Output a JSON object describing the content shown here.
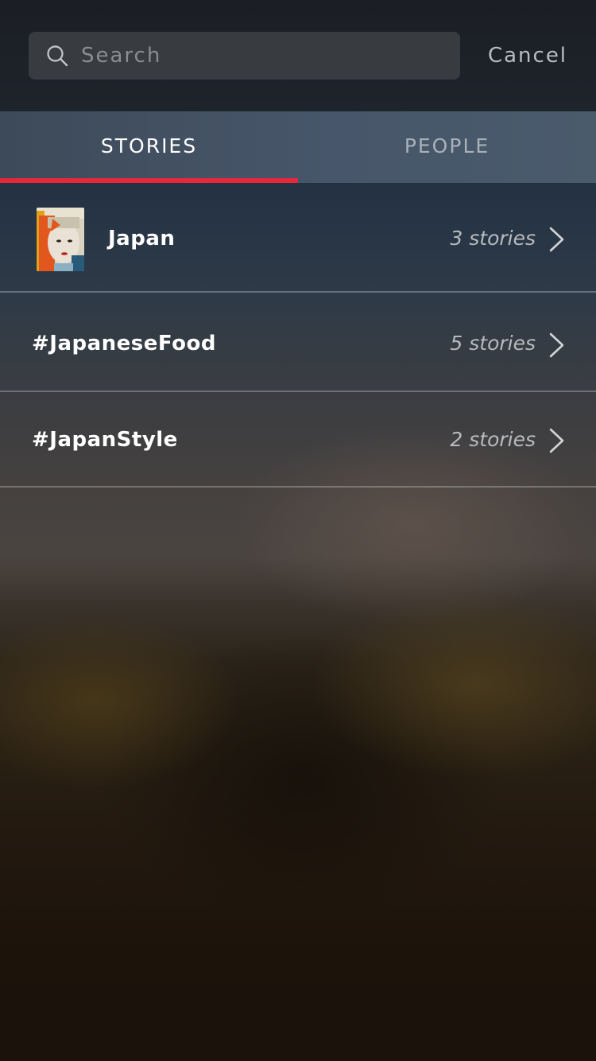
{
  "search": {
    "placeholder": "Search",
    "value": "",
    "icon": "search-icon",
    "cancel_label": "Cancel"
  },
  "tabs": [
    {
      "label": "STORIES",
      "active": true
    },
    {
      "label": "PEOPLE",
      "active": false
    }
  ],
  "colors": {
    "accent": "#e8283a",
    "tab_active_text": "#ffffff",
    "tab_inactive_text": "#a9b0b8"
  },
  "results": [
    {
      "label": "Japan",
      "count": "3 stories",
      "has_thumbnail": true,
      "thumbnail_icon": "photo-thumbnail"
    },
    {
      "label": "#JapaneseFood",
      "count": "5 stories",
      "has_thumbnail": false
    },
    {
      "label": "#JapanStyle",
      "count": "2 stories",
      "has_thumbnail": false
    }
  ]
}
